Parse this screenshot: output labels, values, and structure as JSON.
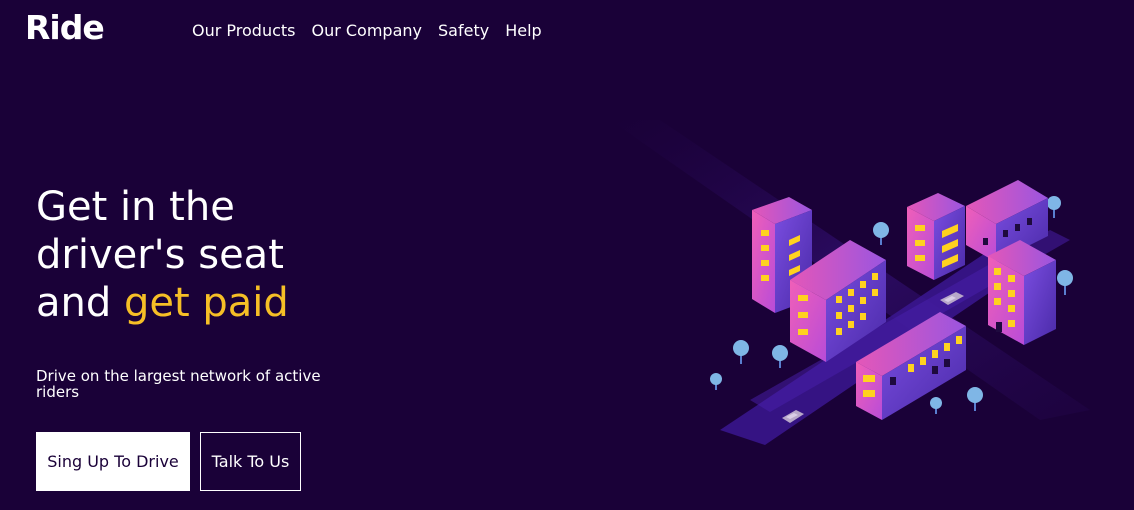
{
  "brand": {
    "logo": "Ride"
  },
  "nav": {
    "items": [
      {
        "label": "Our Products"
      },
      {
        "label": "Our Company"
      },
      {
        "label": "Safety"
      },
      {
        "label": "Help"
      }
    ]
  },
  "hero": {
    "headline_line1": "Get in the",
    "headline_line2": "driver's seat",
    "headline_line3_prefix": "and ",
    "headline_line3_accent": "get paid",
    "subtext": "Drive on the largest network of active riders",
    "primary_button": "Sing Up To Drive",
    "secondary_button": "Talk To Us"
  },
  "colors": {
    "background": "#1a0138",
    "accent": "#f6bf26",
    "building_pink": "#e85ab5",
    "building_purple": "#6a3fd6",
    "window_yellow": "#ffd21f",
    "tree_blue": "#7fb6e6"
  },
  "illustration": {
    "icon": "isometric-city-illustration"
  }
}
